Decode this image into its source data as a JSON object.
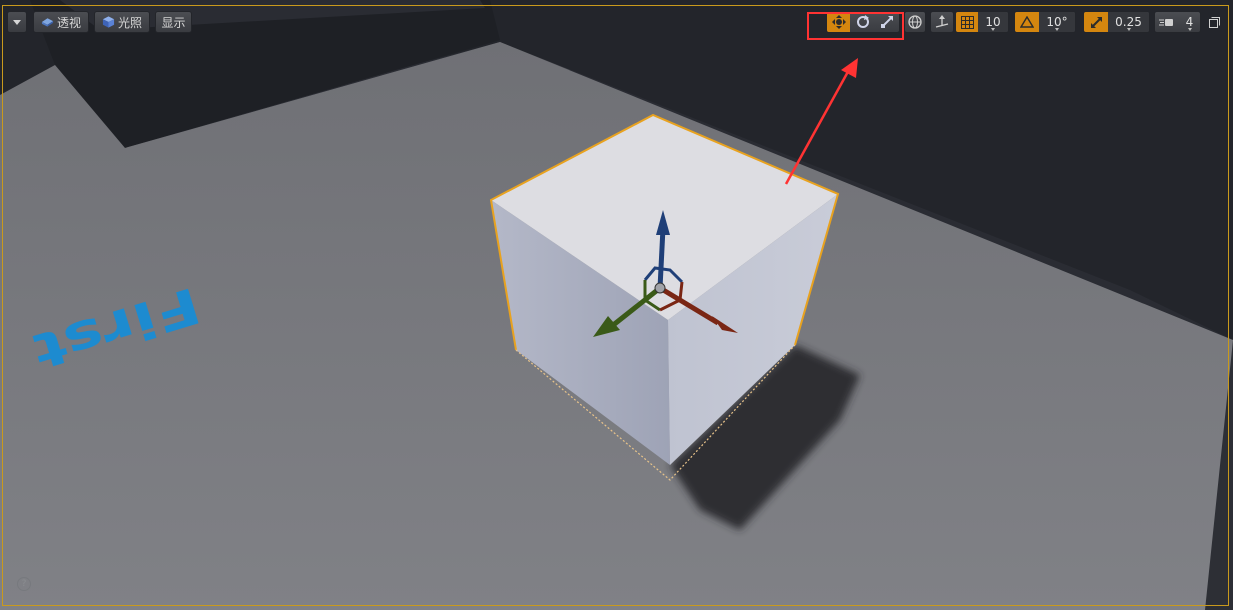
{
  "left_toolbar": {
    "menu_icon": "chevron-down-icon",
    "perspective_label": "透视",
    "lighting_label": "光照",
    "show_label": "显示"
  },
  "right_toolbar": {
    "transform_tools": [
      "translate-icon",
      "rotate-icon",
      "scale-icon"
    ],
    "active_tool": "translate-icon",
    "world_local_icon": "globe-icon",
    "surface_snap_icon": "surface-snap-icon",
    "grid_snap_value": "10",
    "rotation_snap_value": "10°",
    "scale_snap_value": "0.25",
    "camera_speed_value": "4",
    "maximize_icon": "maximize-icon",
    "accent_color": "#d4860f"
  },
  "scene": {
    "floor_text": "First",
    "selection_color": "#e8a21f",
    "annotation_color": "#ff3333"
  },
  "help_icon": "?"
}
